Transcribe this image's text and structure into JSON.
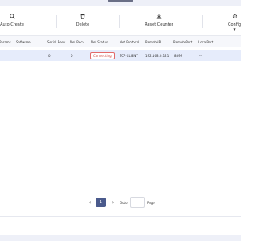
{
  "toolbar": {
    "auto_create": "Auto Create",
    "delete": "Delete",
    "reset_counter": "Reset Counter",
    "config": "Config"
  },
  "table": {
    "headers": [
      "Params",
      "Software",
      "Serial Recv",
      "Net Recv",
      "Net Status",
      "Net Protocol",
      "RemoteIP",
      "RemotePort",
      "LocalPort"
    ],
    "rows": [
      {
        "params": "",
        "software": "",
        "serial_recv": "0",
        "net_recv": "0",
        "net_status": "Connecting",
        "net_protocol": "TCP CLIENT",
        "remote_ip": "192.168.0.121",
        "remote_port": "8899",
        "local_port": "--"
      }
    ]
  },
  "pager": {
    "prev": "‹",
    "current_page": "1",
    "next": "›",
    "goto_label": "Goto",
    "goto_value": "",
    "page_label": "Page"
  },
  "colors": {
    "accent": "#4a5a8c",
    "status_error": "#d0453f",
    "row_selected": "#e6ecfb"
  }
}
